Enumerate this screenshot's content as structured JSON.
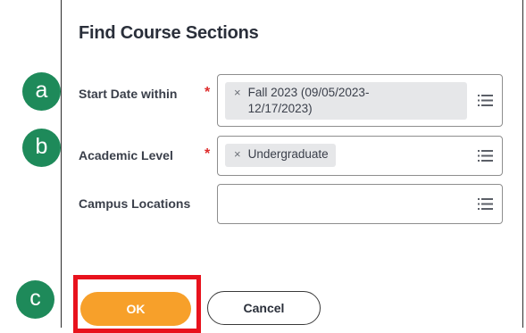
{
  "dialog": {
    "title": "Find Course Sections",
    "fields": [
      {
        "label": "Start Date within",
        "required_mark": "*",
        "selected_value": "Fall 2023 (09/05/2023-\n12/17/2023)",
        "remove_glyph": "×",
        "icon": "list-icon"
      },
      {
        "label": "Academic Level",
        "required_mark": "*",
        "selected_value": "Undergraduate",
        "remove_glyph": "×",
        "icon": "list-icon"
      },
      {
        "label": "Campus Locations",
        "selected_value": "",
        "icon": "list-icon"
      }
    ],
    "buttons": {
      "ok_label": "OK",
      "cancel_label": "Cancel"
    }
  },
  "markers": {
    "a": "a",
    "b": "b",
    "c": "c"
  },
  "colors": {
    "marker_green": "#1e8a5a",
    "ok_orange": "#f7a02a",
    "highlight_red": "#e8121d",
    "required_red": "#de2b2b"
  }
}
